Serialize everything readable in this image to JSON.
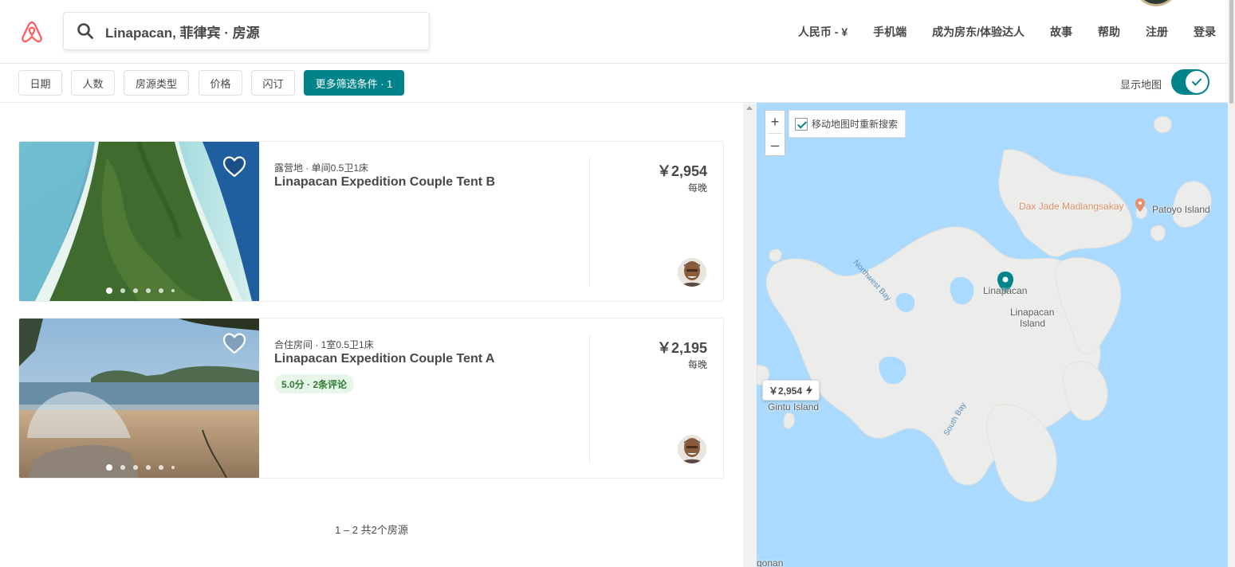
{
  "header": {
    "logo_icon": "airbnb-logo-icon",
    "search_icon": "search-icon",
    "search_text": "Linapacan, 菲律宾 · 房源",
    "nav": [
      "人民币 - ¥",
      "手机端",
      "成为房东/体验达人",
      "故事",
      "帮助",
      "注册",
      "登录"
    ]
  },
  "filters": {
    "chips": [
      "日期",
      "人数",
      "房源类型",
      "价格",
      "闪订"
    ],
    "more_filters": "更多筛选条件 · 1",
    "map_toggle_label": "显示地图",
    "map_toggle_on": true
  },
  "listings": [
    {
      "meta": "露营地 · 单间0.5卫1床",
      "title": "Linapacan Expedition Couple Tent B",
      "price": "￥2,954",
      "per": "每晚",
      "rating": null,
      "photo_count_dots": 6
    },
    {
      "meta": "合住房间 · 1室0.5卫1床",
      "title": "Linapacan Expedition Couple Tent A",
      "price": "￥2,195",
      "per": "每晚",
      "rating": "5.0分 · 2条评论",
      "photo_count_dots": 6
    }
  ],
  "pagination": "1 – 2 共2个房源",
  "map": {
    "zoom_in": "+",
    "zoom_out": "–",
    "redo_search_label": "移动地图时重新搜索",
    "redo_search_checked": true,
    "labels": {
      "poi": "Dax Jade Madlangsakay",
      "patoyo": "Patoyo Island",
      "linapacan": "Linapacan",
      "linapacan_island_1": "Linapacan",
      "linapacan_island_2": "Island",
      "gintu": "Gintu Island",
      "northwest_bay": "Northwest Bay",
      "south_bay": "South Bay",
      "partial": "gonan"
    },
    "price_pin": "￥2,954",
    "colors": {
      "water": "#aadaff",
      "land": "#ececea",
      "accent": "#008489"
    }
  }
}
